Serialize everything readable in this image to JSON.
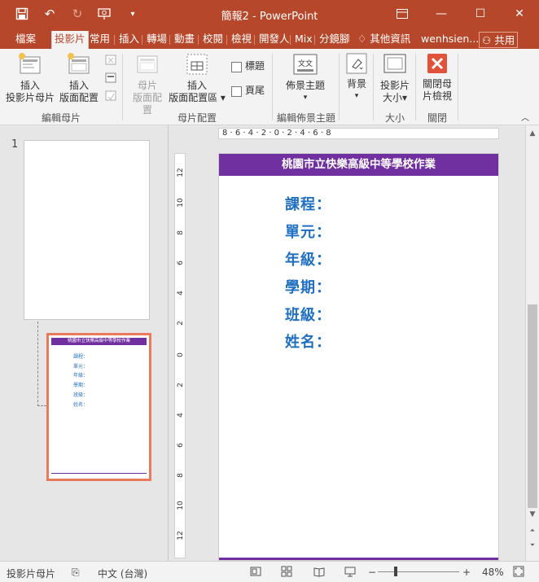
{
  "titlebar": {
    "title": "簡報2 - PowerPoint",
    "bg": "#b7472a"
  },
  "tabs": [
    {
      "label": "檔案",
      "active": false
    },
    {
      "label": "投影片",
      "active": true
    },
    {
      "label": "常用",
      "active": false
    },
    {
      "label": "插入",
      "active": false
    },
    {
      "label": "轉場",
      "active": false
    },
    {
      "label": "動畫",
      "active": false
    },
    {
      "label": "校閱",
      "active": false
    },
    {
      "label": "檢視",
      "active": false
    },
    {
      "label": "開發人",
      "active": false
    },
    {
      "label": "Mix",
      "active": false
    },
    {
      "label": "分鏡腳",
      "active": false
    }
  ],
  "tellme": "其他資訊",
  "user": "wenhsien...",
  "share": "共用",
  "ribbon": {
    "insert_slide_master": "插入\n投影片母片",
    "insert_layout": "插入\n版面配置",
    "master_layout": "母片\n版面配置",
    "insert_placeholder": "插入\n版面配置區",
    "title_check": "標題",
    "footer_check": "頁尾",
    "themes": "佈景主題",
    "background": "背景",
    "slide_size": "投影片\n大小",
    "close_master": "關閉母\n片檢視",
    "groups": {
      "edit_master": "編輯母片",
      "master_layout": "母片配置",
      "edit_theme": "編輯佈景主題",
      "size": "大小",
      "close": "關閉"
    }
  },
  "thumbs": {
    "number": "1",
    "layout_title": "桃園市立快樂高級中等學校作業",
    "layout_lines": [
      "課程：",
      "單元：",
      "年級：",
      "學期：",
      "班級：",
      "姓名："
    ]
  },
  "ruler": {
    "h": "8 · 6 · 4 · 2 · 0 · 2 · 4 · 6 · 8",
    "v": [
      "12",
      "10",
      "8",
      "6",
      "4",
      "2",
      "0",
      "2",
      "4",
      "6",
      "8",
      "10",
      "12"
    ]
  },
  "slide": {
    "banner": "桃園市立快樂高級中等學校作業",
    "fields": [
      "課程：",
      "單元：",
      "年級：",
      "學期：",
      "班級：",
      "姓名："
    ],
    "accent": "#7030a0",
    "text_color": "#1f6fc2"
  },
  "status": {
    "mode": "投影片母片",
    "language": "中文 (台灣)",
    "zoom": "48%",
    "zoom_value": 48
  }
}
